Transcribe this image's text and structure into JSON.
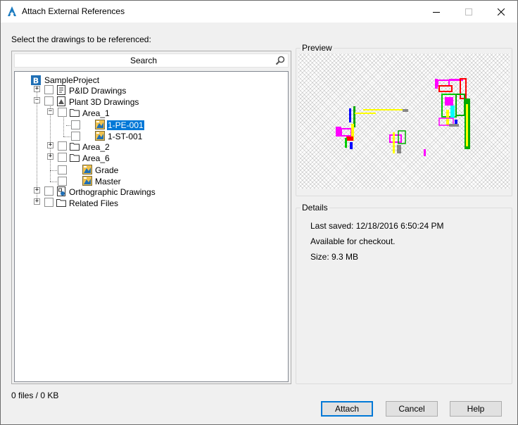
{
  "window": {
    "title": "Attach External References"
  },
  "prompt": "Select the drawings to be referenced:",
  "search": {
    "placeholder": "Search",
    "value": ""
  },
  "tree": {
    "root": "SampleProject",
    "nodes": {
      "pid": "P&ID Drawings",
      "plant3d": "Plant 3D Drawings",
      "area1": "Area_1",
      "pe001": "1-PE-001",
      "st001": "1-ST-001",
      "area2": "Area_2",
      "area6": "Area_6",
      "grade": "Grade",
      "master": "Master",
      "ortho": "Orthographic Drawings",
      "related": "Related Files"
    },
    "selected": "1-PE-001"
  },
  "status": "0 files / 0 KB",
  "preview": {
    "label": "Preview"
  },
  "details": {
    "label": "Details",
    "last_saved": "Last saved: 12/18/2016 6:50:24 PM",
    "availability": "Available for checkout.",
    "size": "Size: 9.3 MB"
  },
  "buttons": {
    "attach": "Attach",
    "cancel": "Cancel",
    "help": "Help"
  },
  "colors": {
    "accent": "#0078d7",
    "folder": "#f0c24d"
  }
}
